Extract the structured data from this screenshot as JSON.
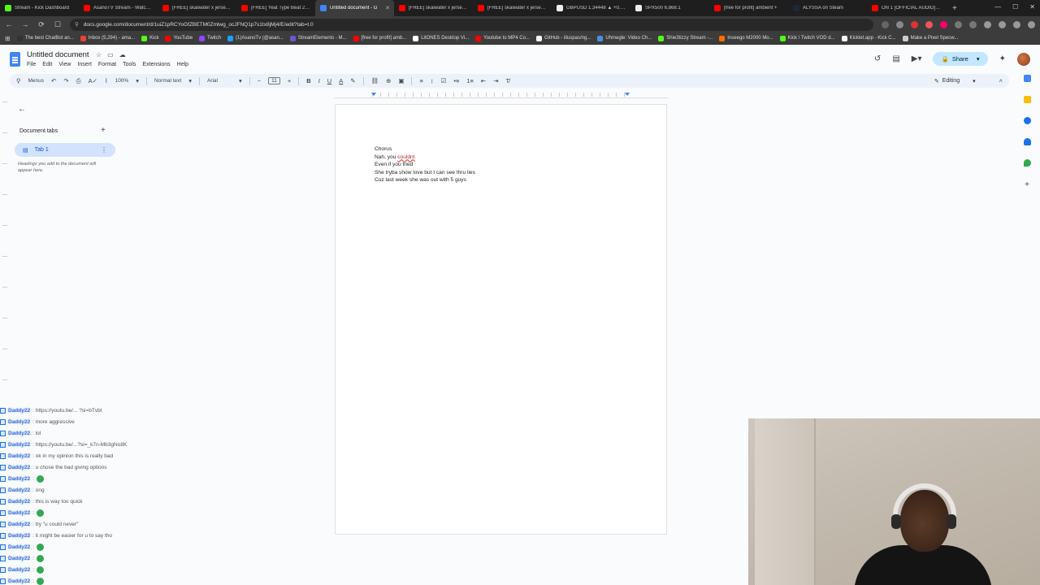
{
  "browser": {
    "tabs": [
      {
        "title": "Stream - Kick Dashboard",
        "color": "#53fc18"
      },
      {
        "title": "AsanoTV Stream - Watch Li",
        "color": "#ff0000"
      },
      {
        "title": "[FREE] skaiwater x jersey cl",
        "color": "#ff0000"
      },
      {
        "title": "[FREE] Yeat Type Beat 2025",
        "color": "#ff0000"
      },
      {
        "title": "Untitled document - G",
        "color": "#4285f4",
        "active": true
      },
      {
        "title": "[FREE] skaiwater x jersey cl",
        "color": "#ff0000"
      },
      {
        "title": "[FREE] skaiwater x jersey cl",
        "color": "#ff0000"
      },
      {
        "title": "GBPUSD 1.34448 ▲ +0.14%",
        "color": "#eeeeee"
      },
      {
        "title": "SPX500 6,868.1",
        "color": "#eeeeee"
      },
      {
        "title": "[free for profit] ambient +",
        "color": "#ff0000"
      },
      {
        "title": "ALYSSA on Steam",
        "color": "#1b2838"
      },
      {
        "title": "ON 1 [OFFICIAL AUDIO] - Y",
        "color": "#ff0000"
      }
    ],
    "new_tab": "+",
    "url": "docs.google.com/document/d/1uiZ1pRCYoGfZBETM0Zmlwg_ocJFNQ1p7s1tx8jMj4/E/edit?tab=t.0",
    "bookmarks": [
      {
        "label": "The best ChatBot an...",
        "color": "#333333"
      },
      {
        "label": "Inbox (5,294) - ama...",
        "color": "#ea4335"
      },
      {
        "label": "Kick",
        "color": "#53fc18"
      },
      {
        "label": "YouTube",
        "color": "#ff0000"
      },
      {
        "label": "Twitch",
        "color": "#9146ff"
      },
      {
        "label": "(1)AsanoTv (@asan...",
        "color": "#1da1f2"
      },
      {
        "label": "StreamElements - M...",
        "color": "#6a5acd"
      },
      {
        "label": "[free for profit] amb...",
        "color": "#ff0000"
      },
      {
        "label": "LitONES Desktop Vi...",
        "color": "#ffffff"
      },
      {
        "label": "Youtube to MP4 Co...",
        "color": "#ff0000"
      },
      {
        "label": "GitHub - illuspas/ng...",
        "color": "#ffffff"
      },
      {
        "label": "Uhmegle: Video Ch...",
        "color": "#4a90e2"
      },
      {
        "label": "Shie3tizzy Stream -...",
        "color": "#53fc18"
      },
      {
        "label": "Inseego M2000 Mo...",
        "color": "#ff6d00"
      },
      {
        "label": "Kick / Twitch VOD d...",
        "color": "#53fc18"
      },
      {
        "label": "Kicklet.app - Kick C...",
        "color": "#ffffff"
      },
      {
        "label": "Make a Pixel Specw...",
        "color": "#cccccc"
      }
    ]
  },
  "docs": {
    "title": "Untitled document",
    "menu": [
      "File",
      "Edit",
      "View",
      "Insert",
      "Format",
      "Tools",
      "Extensions",
      "Help"
    ],
    "share_label": "Share",
    "toolbar": {
      "menus": "Menus",
      "zoom": "100%",
      "style": "Normal text",
      "font": "Arial",
      "font_size": "11",
      "mode": "Editing"
    },
    "sidebar": {
      "heading": "Document tabs",
      "tab_name": "Tab 1",
      "hint": "Headings you add to the document will appear here."
    },
    "body_lines": [
      "Chorus",
      "Nah, you ",
      "couldnt",
      "Even if you tried",
      "She tryba show love but I can see thru lies",
      "Cuz last week she was out with 5 guys"
    ]
  },
  "chat": {
    "messages": [
      {
        "user": "Daddy22",
        "msg": ": https://youtu.be/... ?si=bTvbl"
      },
      {
        "user": "Daddy22",
        "msg": ": more aggressive "
      },
      {
        "user": "Daddy22",
        "msg": ": lol"
      },
      {
        "user": "Daddy22",
        "msg": ": https://youtu.be/...?si=_k7n-Mb3gNo8K"
      },
      {
        "user": "Daddy22",
        "msg": ": ok in my opinion this is really bad"
      },
      {
        "user": "Daddy22",
        "msg": ": u chose the bad giving options"
      },
      {
        "user": "Daddy22",
        "msg": ":",
        "emote": true
      },
      {
        "user": "Daddy22",
        "msg": ": ong"
      },
      {
        "user": "Daddy22",
        "msg": ": this is way too quick"
      },
      {
        "user": "Daddy22",
        "msg": ":",
        "emote": true
      },
      {
        "user": "Daddy22",
        "msg": ": try \"u could never\""
      },
      {
        "user": "Daddy22",
        "msg": ": it might be easier for u to say tho"
      },
      {
        "user": "Daddy22",
        "msg": ":",
        "emote": true
      },
      {
        "user": "Daddy22",
        "msg": ":",
        "emote": true
      },
      {
        "user": "Daddy22",
        "msg": ":",
        "emote": true
      },
      {
        "user": "Daddy22",
        "msg": ":",
        "emote": true
      }
    ]
  },
  "colors": {
    "docs_blue": "#4285f4",
    "share_bg": "#c2e7ff",
    "tab_active_bg": "#d3e3fd",
    "browser_chrome": "#3c3c3c"
  }
}
